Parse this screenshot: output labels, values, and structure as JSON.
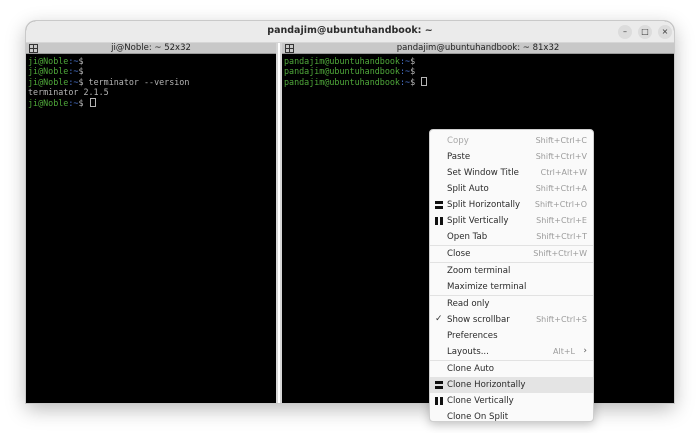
{
  "window": {
    "title": "pandajim@ubuntuhandbook: ~",
    "controls": {
      "minimize": "–",
      "maximize": "□",
      "close": "×"
    }
  },
  "left_pane": {
    "title": "ji@Noble: ~ 52x32",
    "lines": [
      {
        "user": "ji@Noble",
        "path": ":~",
        "rest": "$ "
      },
      {
        "user": "ji@Noble",
        "path": ":~",
        "rest": "$ "
      },
      {
        "user": "ji@Noble",
        "path": ":~",
        "rest": "$ terminator --version"
      },
      {
        "output": "terminator 2.1.5"
      },
      {
        "user": "ji@Noble",
        "path": ":~",
        "rest": "$ "
      }
    ]
  },
  "right_pane": {
    "title": "pandajim@ubuntuhandbook: ~ 81x32",
    "lines": [
      {
        "user": "pandajim@ubuntuhandbook",
        "path": ":~",
        "rest": "$ "
      },
      {
        "user": "pandajim@ubuntuhandbook",
        "path": ":~",
        "rest": "$ "
      },
      {
        "user": "pandajim@ubuntuhandbook",
        "path": ":~",
        "rest": "$ "
      }
    ]
  },
  "context_menu": {
    "items": [
      {
        "label": "Copy",
        "accel": "Shift+Ctrl+C",
        "disabled": true
      },
      {
        "label": "Paste",
        "accel": "Shift+Ctrl+V"
      },
      {
        "label": "Set Window Title",
        "accel": "Ctrl+Alt+W"
      },
      {
        "label": "Split Auto",
        "accel": "Shift+Ctrl+A"
      },
      {
        "label": "Split Horizontally",
        "accel": "Shift+Ctrl+O",
        "icon": "split-horizontal-icon"
      },
      {
        "label": "Split Vertically",
        "accel": "Shift+Ctrl+E",
        "icon": "split-vertical-icon"
      },
      {
        "label": "Open Tab",
        "accel": "Shift+Ctrl+T"
      },
      {
        "label": "Close",
        "accel": "Shift+Ctrl+W"
      },
      {
        "label": "Zoom terminal",
        "accel": ""
      },
      {
        "label": "Maximize terminal",
        "accel": ""
      },
      {
        "label": "Read only",
        "accel": ""
      },
      {
        "label": "Show scrollbar",
        "accel": "Shift+Ctrl+S",
        "checked": true
      },
      {
        "label": "Preferences",
        "accel": ""
      },
      {
        "label": "Layouts...",
        "accel": "Alt+L",
        "submenu": true
      },
      {
        "label": "Clone Auto",
        "accel": ""
      },
      {
        "label": "Clone Horizontally",
        "accel": "",
        "icon": "split-horizontal-icon",
        "highlighted": true
      },
      {
        "label": "Clone Vertically",
        "accel": "",
        "icon": "split-vertical-icon"
      },
      {
        "label": "Clone On Split",
        "accel": ""
      }
    ],
    "separators_after": [
      6,
      7,
      9,
      13
    ]
  },
  "colors": {
    "prompt_user": "#4fa83a",
    "prompt_path": "#4870c6",
    "terminal_bg": "#000000",
    "terminal_fg": "#b5b5b5"
  }
}
